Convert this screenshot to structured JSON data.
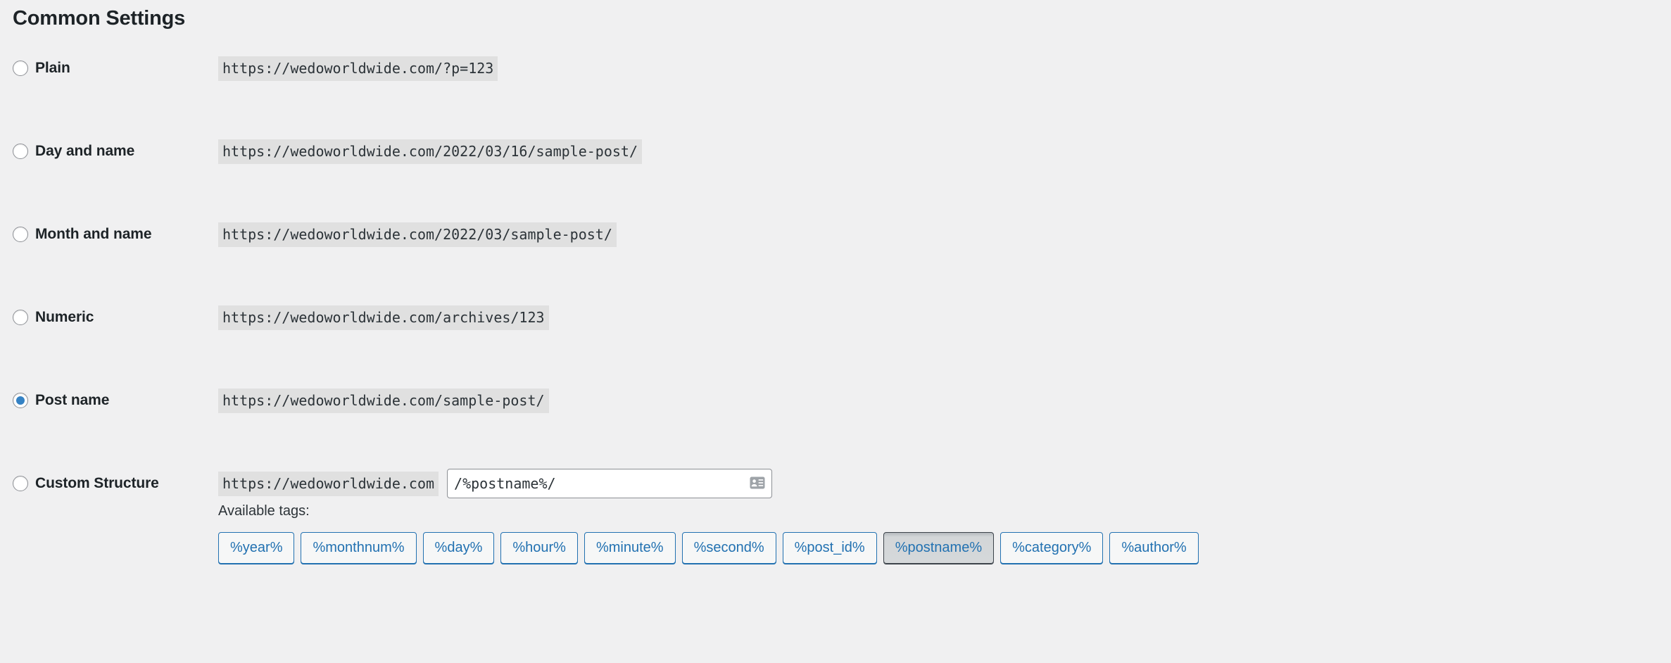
{
  "page": {
    "title": "Common Settings",
    "site_url": "https://wedoworldwide.com"
  },
  "permalink_options": [
    {
      "id": "plain",
      "label": "Plain",
      "example": "https://wedoworldwide.com/?p=123",
      "selected": false
    },
    {
      "id": "day-and-name",
      "label": "Day and name",
      "example": "https://wedoworldwide.com/2022/03/16/sample-post/",
      "selected": false
    },
    {
      "id": "month-and-name",
      "label": "Month and name",
      "example": "https://wedoworldwide.com/2022/03/sample-post/",
      "selected": false
    },
    {
      "id": "numeric",
      "label": "Numeric",
      "example": "https://wedoworldwide.com/archives/123",
      "selected": false
    },
    {
      "id": "post-name",
      "label": "Post name",
      "example": "https://wedoworldwide.com/sample-post/",
      "selected": true
    },
    {
      "id": "custom-structure",
      "label": "Custom Structure",
      "example": "https://wedoworldwide.com",
      "selected": false
    }
  ],
  "custom_structure": {
    "prefix": "https://wedoworldwide.com",
    "value": "/%postname%/",
    "placeholder": "",
    "autofill_icon": "contact-card-icon"
  },
  "available_tags": {
    "label": "Available tags:",
    "tags": [
      {
        "label": "%year%",
        "active": false
      },
      {
        "label": "%monthnum%",
        "active": false
      },
      {
        "label": "%day%",
        "active": false
      },
      {
        "label": "%hour%",
        "active": false
      },
      {
        "label": "%minute%",
        "active": false
      },
      {
        "label": "%second%",
        "active": false
      },
      {
        "label": "%post_id%",
        "active": false
      },
      {
        "label": "%postname%",
        "active": true
      },
      {
        "label": "%category%",
        "active": false
      },
      {
        "label": "%author%",
        "active": false
      }
    ]
  },
  "colors": {
    "background": "#f0f0f1",
    "text": "#1d2327",
    "code_background": "#e0e0e0",
    "radio_selected": "#3582c4",
    "link_blue": "#2271b1",
    "active_tag_border": "#3c434a"
  }
}
